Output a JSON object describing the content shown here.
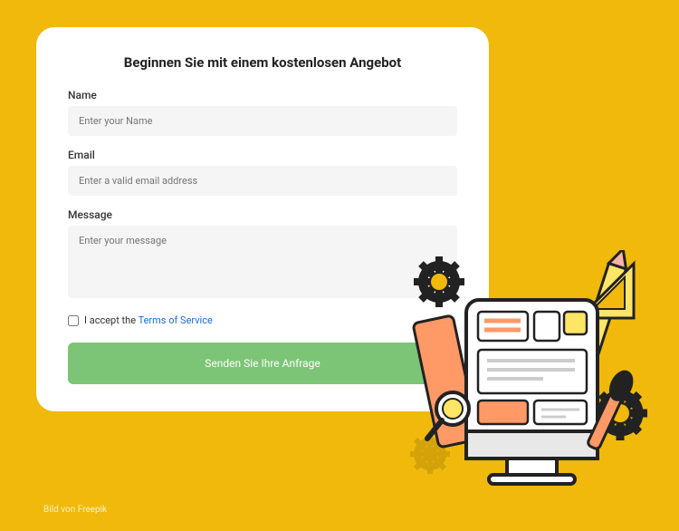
{
  "form": {
    "title": "Beginnen Sie mit einem kostenlosen Angebot",
    "name_label": "Name",
    "name_placeholder": "Enter your Name",
    "email_label": "Email",
    "email_placeholder": "Enter a valid email address",
    "message_label": "Message",
    "message_placeholder": "Enter your message",
    "accept_text": "I accept the ",
    "tos_link": "Terms of Service",
    "submit": "Senden Sie Ihre Anfrage"
  },
  "credit": "Bild von Freepik"
}
